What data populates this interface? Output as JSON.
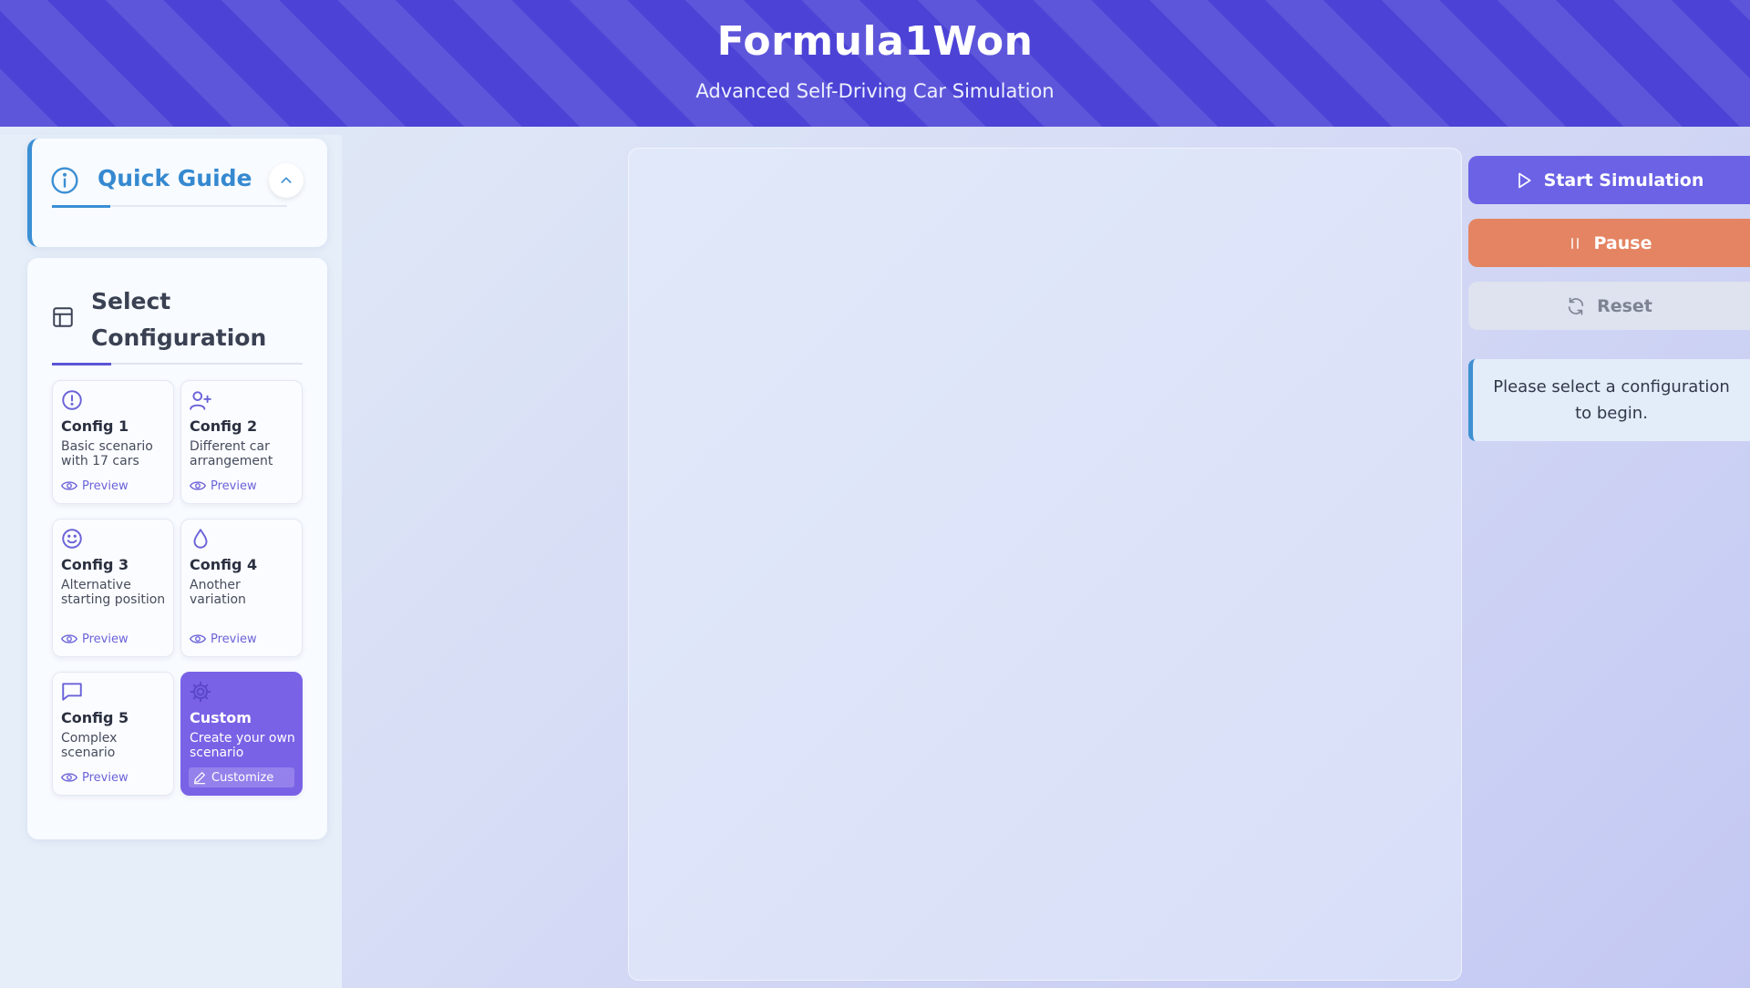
{
  "app": {
    "title": "Formula1Won",
    "subtitle": "Advanced Self-Driving Car Simulation"
  },
  "quick_guide": {
    "title": "Quick Guide",
    "icon": "info-icon",
    "toggle_icon": "chevron-up-icon",
    "accent": "#3b8fd4"
  },
  "config_panel": {
    "title": "Select Configuration",
    "icon": "layout-icon",
    "tiles": [
      {
        "name": "Config 1",
        "description": "Basic scenario with 17 cars",
        "action": "Preview",
        "icon": "alert-circle-icon"
      },
      {
        "name": "Config 2",
        "description": "Different car arrangement",
        "action": "Preview",
        "icon": "user-plus-icon"
      },
      {
        "name": "Config 3",
        "description": "Alternative starting position",
        "action": "Preview",
        "icon": "smile-icon"
      },
      {
        "name": "Config 4",
        "description": "Another variation",
        "action": "Preview",
        "icon": "droplet-icon"
      },
      {
        "name": "Config 5",
        "description": "Complex scenario",
        "action": "Preview",
        "icon": "message-square-icon"
      },
      {
        "name": "Custom",
        "description": "Create your own scenario",
        "action": "Customize",
        "icon": "settings-icon",
        "selected": true
      }
    ]
  },
  "controls": {
    "start_label": "Start Simulation",
    "pause_label": "Pause",
    "reset_label": "Reset"
  },
  "status": {
    "message": "Please select a configuration to begin."
  },
  "colors": {
    "header": "#4c43d6",
    "primary": "#6b62e6",
    "pause": "#e48462",
    "reset": "#dfe2ef",
    "custom_tile": "#7a62e6"
  }
}
